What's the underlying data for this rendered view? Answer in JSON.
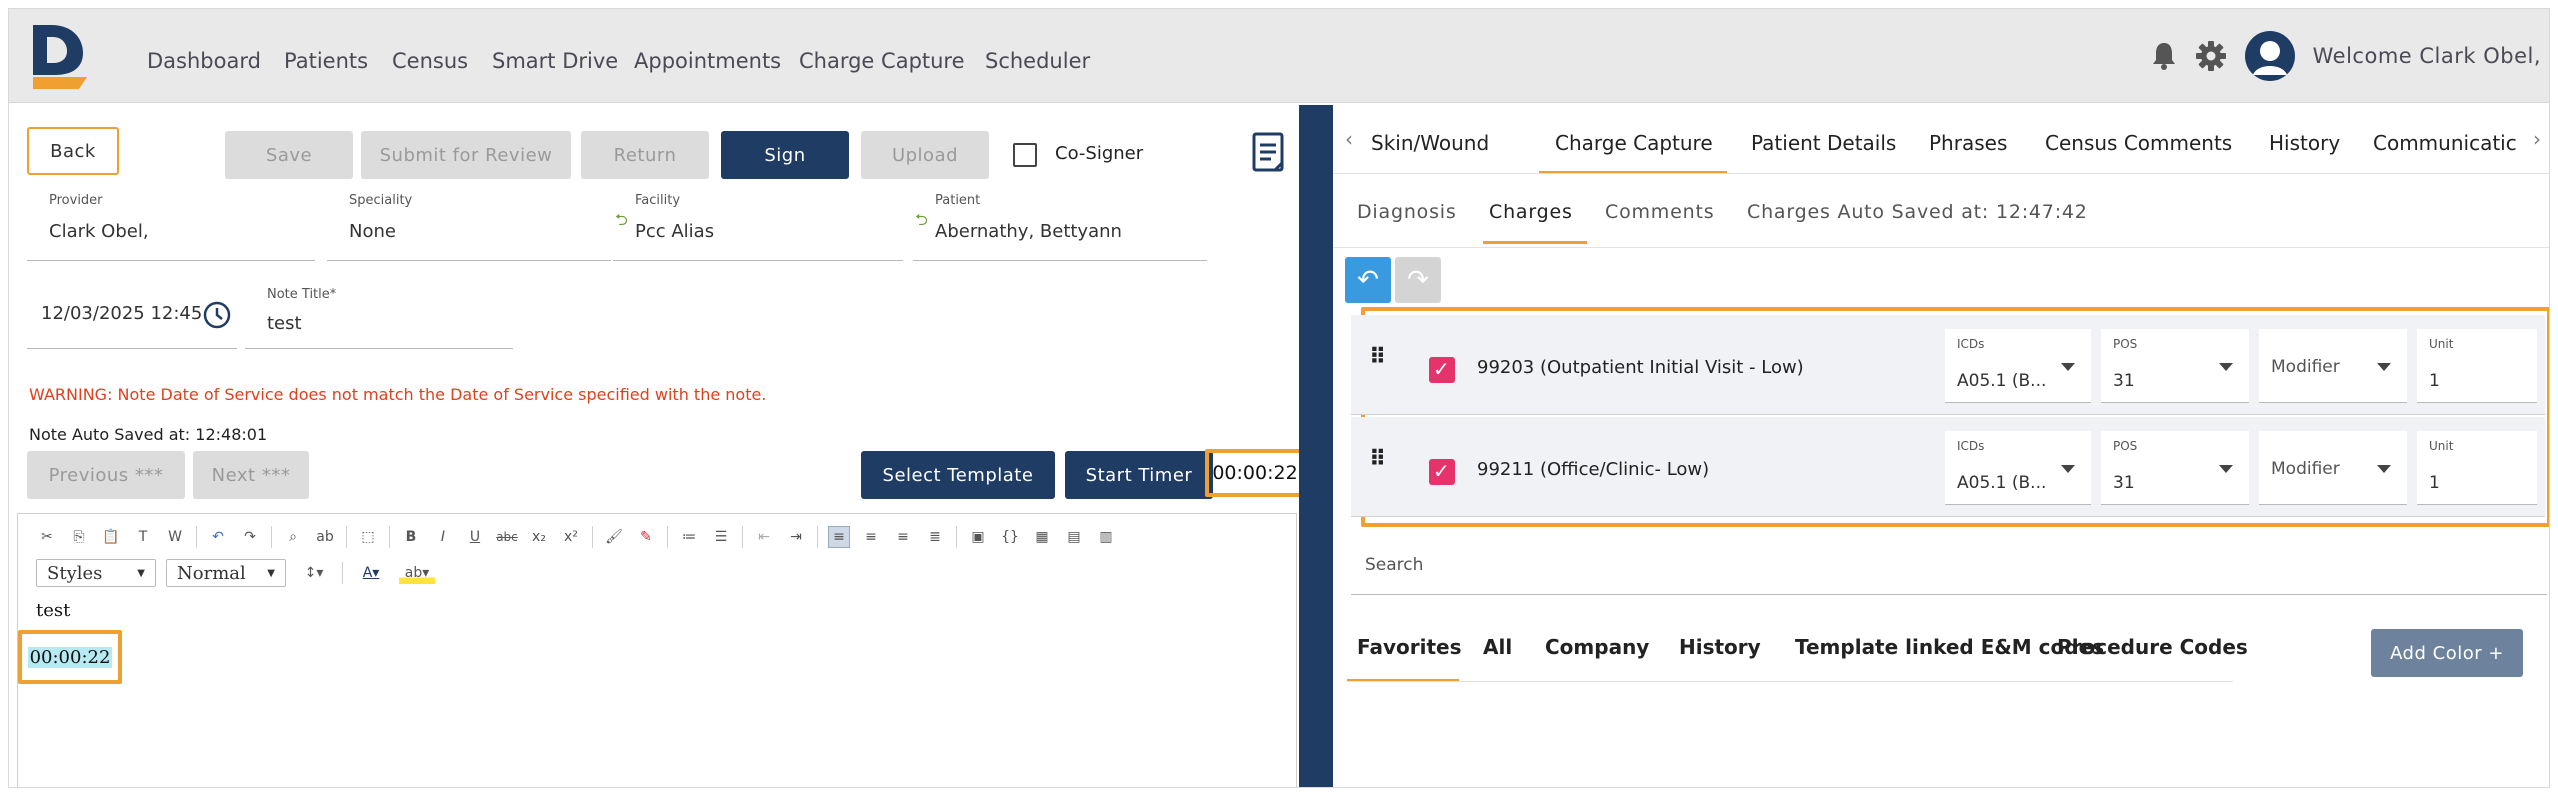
{
  "nav": {
    "items": [
      "Dashboard",
      "Patients",
      "Census",
      "Smart Drive",
      "Appointments",
      "Charge Capture",
      "Scheduler"
    ],
    "welcome": "Welcome Clark Obel,"
  },
  "toolbar": {
    "back": "Back",
    "save": "Save",
    "submit": "Submit for Review",
    "return": "Return",
    "sign": "Sign",
    "upload": "Upload",
    "cosigner": "Co-Signer"
  },
  "fields": {
    "provider_label": "Provider",
    "provider_value": "Clark Obel,",
    "speciality_label": "Speciality",
    "speciality_value": "None",
    "facility_label": "Facility",
    "facility_value": "Pcc Alias",
    "patient_label": "Patient",
    "patient_value": "Abernathy, Bettyann",
    "date_value": "12/03/2025 12:45",
    "title_label": "Note Title*",
    "title_value": "test"
  },
  "warning": "WARNING: Note Date of Service does not match the Date of Service specified with the note.",
  "autosave": "Note Auto Saved at: 12:48:01",
  "actions": {
    "previous": "Previous ***",
    "next": "Next ***",
    "select_template": "Select Template",
    "start_timer": "Start Timer",
    "timer_value": "00:00:22"
  },
  "editor": {
    "styles": "Styles",
    "format": "Normal",
    "line1": "test",
    "line2": "00:00:22"
  },
  "right": {
    "tabs": [
      "Skin/Wound",
      "Charge Capture",
      "Patient Details",
      "Phrases",
      "Census Comments",
      "History",
      "Communicatic"
    ],
    "subtabs": [
      "Diagnosis",
      "Charges",
      "Comments"
    ],
    "charges_autosave": "Charges Auto Saved at: 12:47:42",
    "charges": [
      {
        "code": "99203 (Outpatient Initial Visit - Low)",
        "icd_label": "ICDs",
        "icd": "A05.1 (B...",
        "pos_label": "POS",
        "pos": "31",
        "modifier": "Modifier",
        "unit_label": "Unit",
        "unit": "1"
      },
      {
        "code": "99211 (Office/Clinic- Low)",
        "icd_label": "ICDs",
        "icd": "A05.1 (B...",
        "pos_label": "POS",
        "pos": "31",
        "modifier": "Modifier",
        "unit_label": "Unit",
        "unit": "1"
      }
    ],
    "search_placeholder": "Search",
    "bottom_tabs": [
      "Favorites",
      "All",
      "Company",
      "History",
      "Template linked E&M codes",
      "Procedure Codes"
    ],
    "add_color": "Add Color +"
  },
  "colors": {
    "primary": "#1f3c64",
    "accent_orange": "#f0a030",
    "checkbox_pink": "#e6336c",
    "warning_red": "#e2401c"
  }
}
